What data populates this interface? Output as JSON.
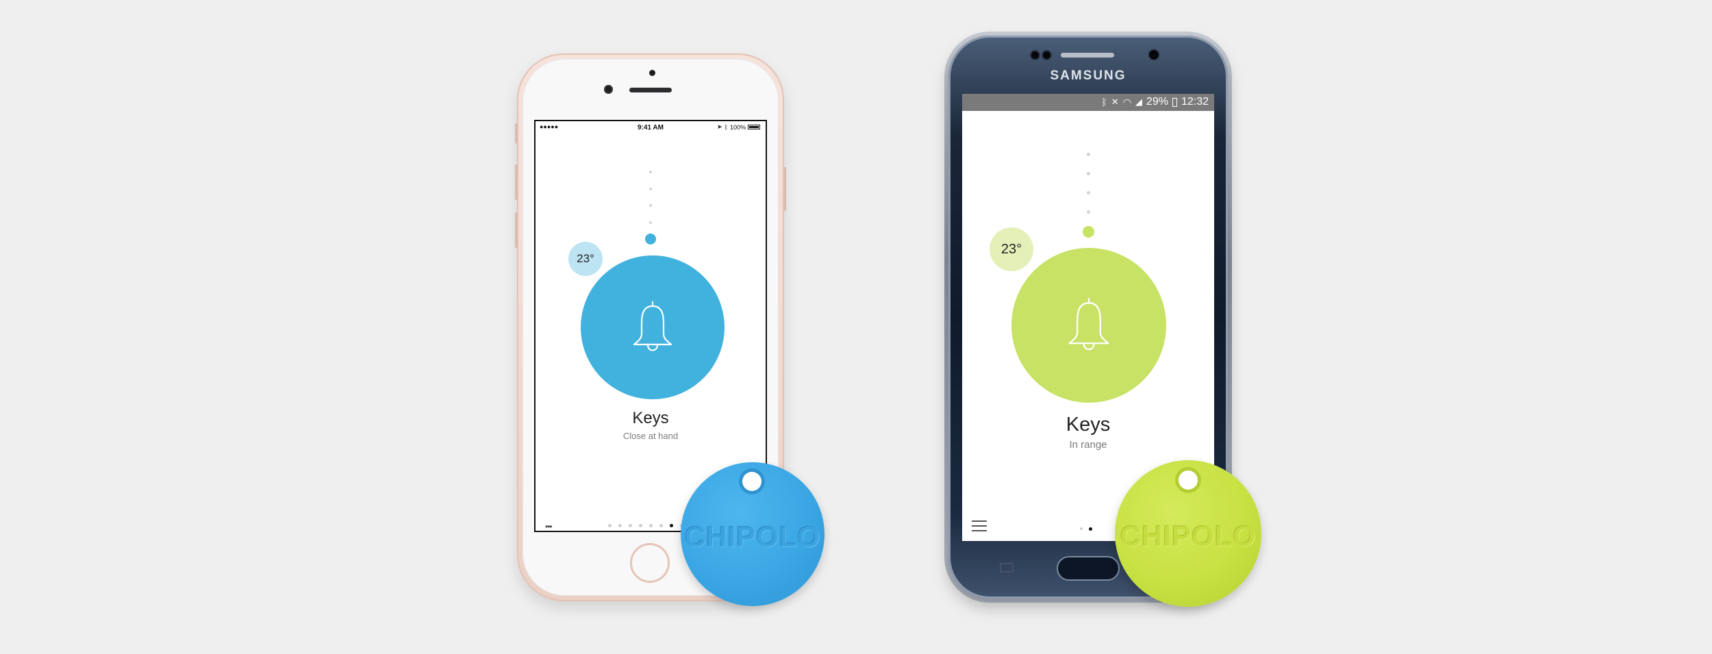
{
  "colors": {
    "background": "#efefef",
    "blue_accent": "#41b2de",
    "blue_light": "#bde4f3",
    "blue_tag": "#3aa6e4",
    "green_accent": "#c7e265",
    "green_light": "#e5f0b9",
    "green_tag": "#c8e142",
    "iphone_gold": "#f2d9cf",
    "samsung_navy": "#0f1a2b"
  },
  "iphone": {
    "status": {
      "signal": "●●●●●",
      "time": "9:41 AM",
      "battery": "100%",
      "icons": "location-icon bluetooth-icon"
    },
    "temperature": "23°",
    "item_name": "Keys",
    "item_status": "Close at hand",
    "menu": "•••",
    "page_count": 8,
    "active_page": 7
  },
  "samsung": {
    "brand": "SAMSUNG",
    "status": {
      "battery": "29%",
      "time": "12:32",
      "icons": "bluetooth-icon mute-icon wifi-icon signal-icon"
    },
    "temperature": "23°",
    "item_name": "Keys",
    "item_status": "In range",
    "page_count": 2,
    "active_page": 2
  },
  "tags": {
    "blue_label": "CHIPOLO",
    "green_label": "CHIPOLO"
  }
}
